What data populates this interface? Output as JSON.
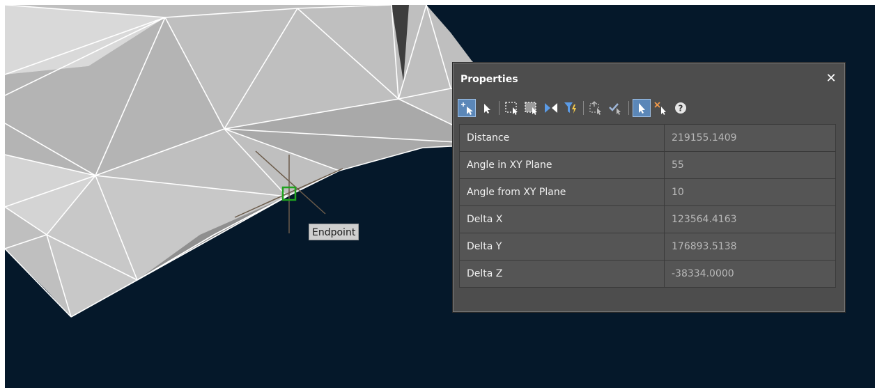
{
  "viewport": {
    "background": "#05182a",
    "snap_tooltip": "Endpoint",
    "snap_marker_color": "#1fa31f"
  },
  "properties_panel": {
    "title": "Properties",
    "close_icon": "close-icon",
    "toolbar_icons": [
      "add-to-selection-icon",
      "select-objects-icon",
      "window-select-icon",
      "crossing-select-icon",
      "swap-selection-icon",
      "quick-select-filter-icon",
      "move-icon",
      "check-select-icon",
      "pickadd-toggle-icon",
      "deselect-icon",
      "help-icon"
    ],
    "rows": [
      {
        "name": "Distance",
        "value": "219155.1409"
      },
      {
        "name": "Angle in XY Plane",
        "value": "55"
      },
      {
        "name": "Angle from XY Plane",
        "value": "10"
      },
      {
        "name": "Delta X",
        "value": "123564.4163"
      },
      {
        "name": "Delta Y",
        "value": "176893.5138"
      },
      {
        "name": "Delta Z",
        "value": "-38334.0000"
      }
    ]
  }
}
